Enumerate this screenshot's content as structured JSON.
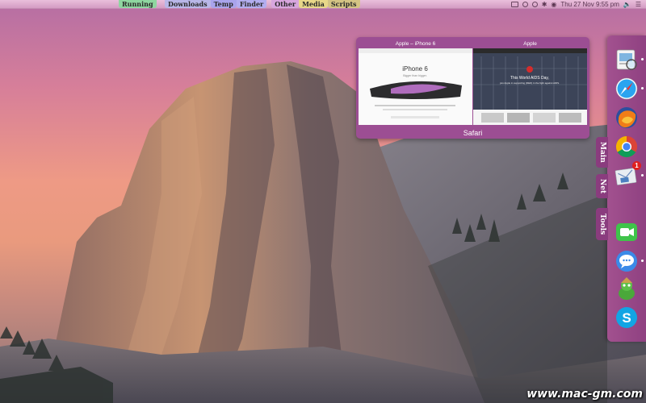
{
  "menubar": {
    "left_tab": {
      "label": "Running",
      "color": "#8fd6a0"
    },
    "tabs": [
      {
        "label": "Downloads",
        "color": "#b9b7e8"
      },
      {
        "label": "Temp",
        "color": "#a9a4ec"
      },
      {
        "label": "Finder",
        "color": "#b3aef0"
      },
      {
        "label": "Other",
        "color": "#d8a6de"
      },
      {
        "label": "Media",
        "color": "#e8d889"
      },
      {
        "label": "Scripts",
        "color": "#d4c484"
      }
    ],
    "status": {
      "datetime": "Thu 27 Nov  9:55 pm",
      "icons": [
        "battery-icon",
        "message-icon",
        "clock-icon",
        "bluetooth-icon",
        "wifi-icon",
        "volume-icon",
        "list-icon"
      ]
    }
  },
  "safari_popover": {
    "app_label": "Safari",
    "windows": [
      {
        "title": "Apple – iPhone 6",
        "headline": "iPhone 6",
        "sub": "Bigger than bigger."
      },
      {
        "title": "Apple",
        "headline": "This World AIDS Day,",
        "sub": "join Apple in supporting (RED) in the fight against AIDS."
      }
    ]
  },
  "dock": {
    "side_tabs": [
      "Main",
      "Net",
      "Tools"
    ],
    "apps": [
      {
        "name": "Preview",
        "icon": "preview-icon"
      },
      {
        "name": "Safari",
        "icon": "safari-icon"
      },
      {
        "name": "Firefox",
        "icon": "firefox-icon"
      },
      {
        "name": "Chrome",
        "icon": "chrome-icon"
      },
      {
        "name": "Mail",
        "icon": "mail-icon",
        "badge": "1"
      },
      {
        "name": "FaceTime",
        "icon": "facetime-icon"
      },
      {
        "name": "Messages",
        "icon": "messages-icon"
      },
      {
        "name": "Adium",
        "icon": "adium-icon"
      },
      {
        "name": "Skype",
        "icon": "skype-icon"
      }
    ]
  },
  "watermark": "www.mac-gm.com"
}
